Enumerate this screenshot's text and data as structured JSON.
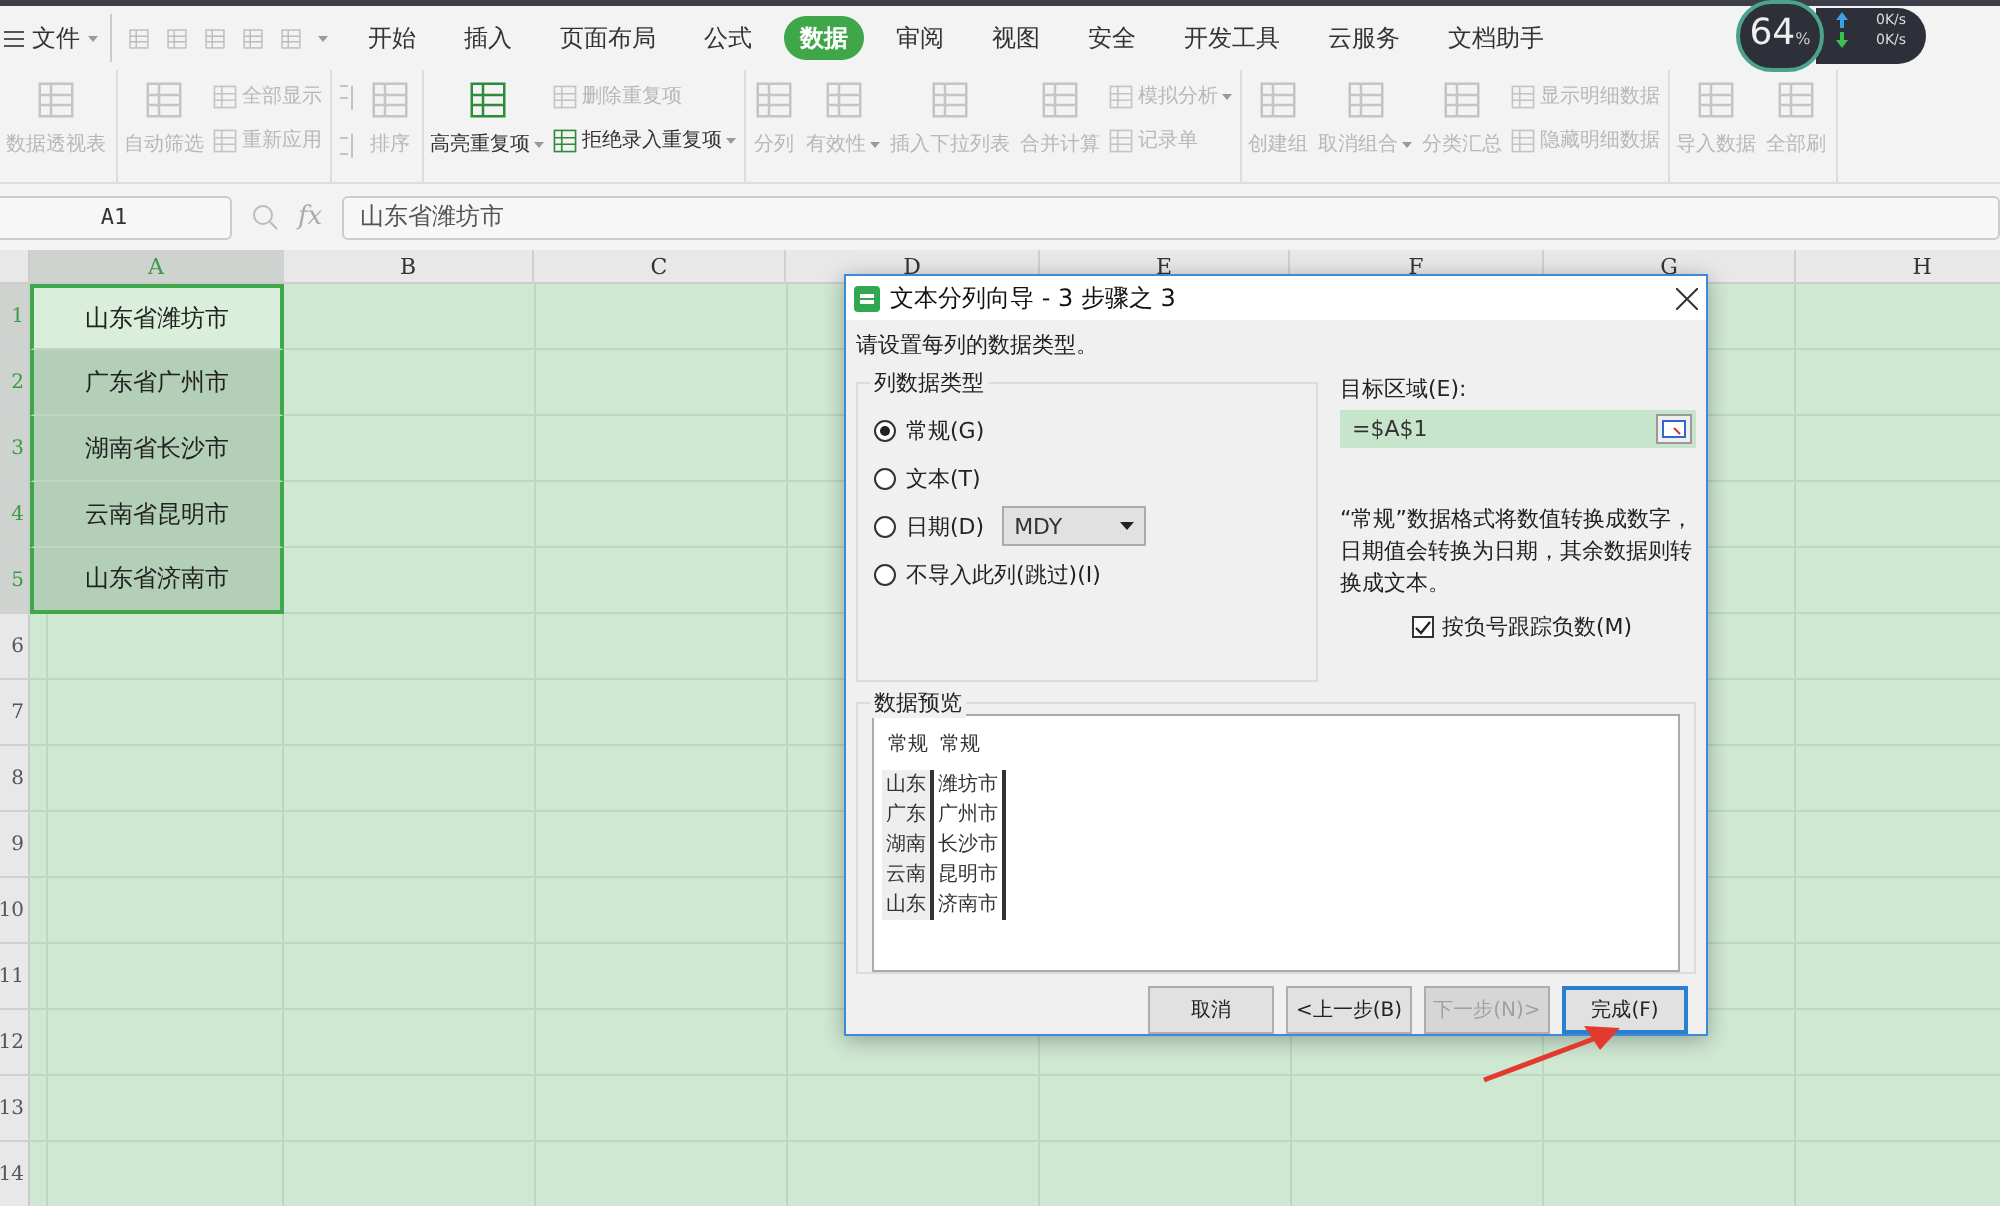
{
  "menu": {
    "label": "文件"
  },
  "tabs": [
    {
      "label": "开始",
      "selected": false
    },
    {
      "label": "插入",
      "selected": false
    },
    {
      "label": "页面布局",
      "selected": false
    },
    {
      "label": "公式",
      "selected": false
    },
    {
      "label": "数据",
      "selected": true
    },
    {
      "label": "审阅",
      "selected": false
    },
    {
      "label": "视图",
      "selected": false
    },
    {
      "label": "安全",
      "selected": false
    },
    {
      "label": "开发工具",
      "selected": false
    },
    {
      "label": "云服务",
      "selected": false
    },
    {
      "label": "文档助手",
      "selected": false
    }
  ],
  "speed_widget": {
    "percent": "64",
    "unit": "%",
    "upload": "0K/s",
    "download": "0K/s"
  },
  "ribbon": {
    "groups": [
      {
        "items": [
          {
            "kind": "large",
            "label": "数据透视表",
            "disabled": true,
            "dropdown": false
          }
        ]
      },
      {
        "items": [
          {
            "kind": "large",
            "label": "自动筛选",
            "disabled": true,
            "dropdown": false
          },
          {
            "kind": "stack",
            "entries": [
              {
                "label": "全部显示",
                "disabled": true,
                "dropdown": false
              },
              {
                "label": "重新应用",
                "disabled": true,
                "dropdown": false
              }
            ]
          }
        ]
      },
      {
        "items": [
          {
            "kind": "sortpair",
            "disabled": true
          },
          {
            "kind": "large",
            "label": "排序",
            "disabled": true,
            "dropdown": false
          }
        ]
      },
      {
        "items": [
          {
            "kind": "large",
            "label": "高亮重复项",
            "disabled": false,
            "dropdown": true
          },
          {
            "kind": "stack",
            "entries": [
              {
                "label": "删除重复项",
                "disabled": true,
                "dropdown": false
              },
              {
                "label": "拒绝录入重复项",
                "disabled": false,
                "dropdown": true
              }
            ]
          }
        ]
      },
      {
        "items": [
          {
            "kind": "large",
            "label": "分列",
            "disabled": true,
            "dropdown": false
          },
          {
            "kind": "large",
            "label": "有效性",
            "disabled": true,
            "dropdown": true
          },
          {
            "kind": "large",
            "label": "插入下拉列表",
            "disabled": true,
            "dropdown": false
          },
          {
            "kind": "large",
            "label": "合并计算",
            "disabled": true,
            "dropdown": false
          },
          {
            "kind": "stack",
            "entries": [
              {
                "label": "模拟分析",
                "disabled": true,
                "dropdown": true
              },
              {
                "label": "记录单",
                "disabled": true,
                "dropdown": false
              }
            ]
          }
        ]
      },
      {
        "items": [
          {
            "kind": "large",
            "label": "创建组",
            "disabled": true,
            "dropdown": false
          },
          {
            "kind": "large",
            "label": "取消组合",
            "disabled": true,
            "dropdown": true
          },
          {
            "kind": "large",
            "label": "分类汇总",
            "disabled": true,
            "dropdown": false
          },
          {
            "kind": "stack",
            "entries": [
              {
                "label": "显示明细数据",
                "disabled": true,
                "dropdown": false
              },
              {
                "label": "隐藏明细数据",
                "disabled": true,
                "dropdown": false
              }
            ]
          }
        ]
      },
      {
        "items": [
          {
            "kind": "large",
            "label": "导入数据",
            "disabled": true,
            "dropdown": false
          },
          {
            "kind": "large",
            "label": "全部刷",
            "disabled": true,
            "dropdown": false
          }
        ]
      }
    ]
  },
  "name_box": "A1",
  "formula_bar": {
    "fx": "fx",
    "value": "山东省潍坊市"
  },
  "columns": [
    {
      "label": "A",
      "selected": true
    },
    {
      "label": "B",
      "selected": false
    },
    {
      "label": "C",
      "selected": false
    },
    {
      "label": "D",
      "selected": false
    },
    {
      "label": "E",
      "selected": false
    },
    {
      "label": "F",
      "selected": false
    },
    {
      "label": "G",
      "selected": false
    },
    {
      "label": "H",
      "selected": false
    }
  ],
  "rows": [
    {
      "number": "1",
      "selected": true,
      "cells": [
        {
          "text": "山东省潍坊市",
          "active": true
        }
      ]
    },
    {
      "number": "2",
      "selected": true,
      "cells": [
        {
          "text": "广东省广州市",
          "active": false
        }
      ]
    },
    {
      "number": "3",
      "selected": true,
      "cells": [
        {
          "text": "湖南省长沙市",
          "active": false
        }
      ]
    },
    {
      "number": "4",
      "selected": true,
      "cells": [
        {
          "text": "云南省昆明市",
          "active": false
        }
      ]
    },
    {
      "number": "5",
      "selected": true,
      "cells": [
        {
          "text": "山东省济南市",
          "active": false
        }
      ]
    },
    {
      "number": "6",
      "selected": false,
      "cells": []
    },
    {
      "number": "7",
      "selected": false,
      "cells": []
    },
    {
      "number": "8",
      "selected": false,
      "cells": []
    },
    {
      "number": "9",
      "selected": false,
      "cells": []
    },
    {
      "number": "10",
      "selected": false,
      "cells": []
    },
    {
      "number": "11",
      "selected": false,
      "cells": []
    },
    {
      "number": "12",
      "selected": false,
      "cells": []
    },
    {
      "number": "13",
      "selected": false,
      "cells": []
    },
    {
      "number": "14",
      "selected": false,
      "cells": []
    }
  ],
  "dialog": {
    "title": "文本分列向导 - 3 步骤之 3",
    "prompt": "请设置每列的数据类型。",
    "type_group": "列数据类型",
    "options": [
      {
        "label": "常规(G)",
        "selected": true
      },
      {
        "label": "文本(T)",
        "selected": false
      },
      {
        "label": "日期(D)",
        "selected": false,
        "dropdown": "MDY"
      },
      {
        "label": "不导入此列(跳过)(I)",
        "selected": false
      }
    ],
    "target_label": "目标区域(E):",
    "target_value": "=$A$1",
    "note": "“常规”数据格式将数值转换成数字，日期值会转换为日期，其余数据则转换成文本。",
    "checkbox": {
      "label": "按负号跟踪负数(M)",
      "checked": true
    },
    "preview_title": "数据预览",
    "preview": {
      "headers": [
        "常规",
        "常规"
      ],
      "rows": [
        [
          "山东",
          "潍坊市"
        ],
        [
          "广东",
          "广州市"
        ],
        [
          "湖南",
          "长沙市"
        ],
        [
          "云南",
          "昆明市"
        ],
        [
          "山东",
          "济南市"
        ]
      ]
    },
    "buttons": [
      {
        "label": "取消",
        "disabled": false,
        "default": false
      },
      {
        "label": "<上一步(B)",
        "disabled": false,
        "default": false
      },
      {
        "label": "下一步(N)>",
        "disabled": true,
        "default": false
      },
      {
        "label": "完成(F)",
        "disabled": false,
        "default": true
      }
    ]
  }
}
